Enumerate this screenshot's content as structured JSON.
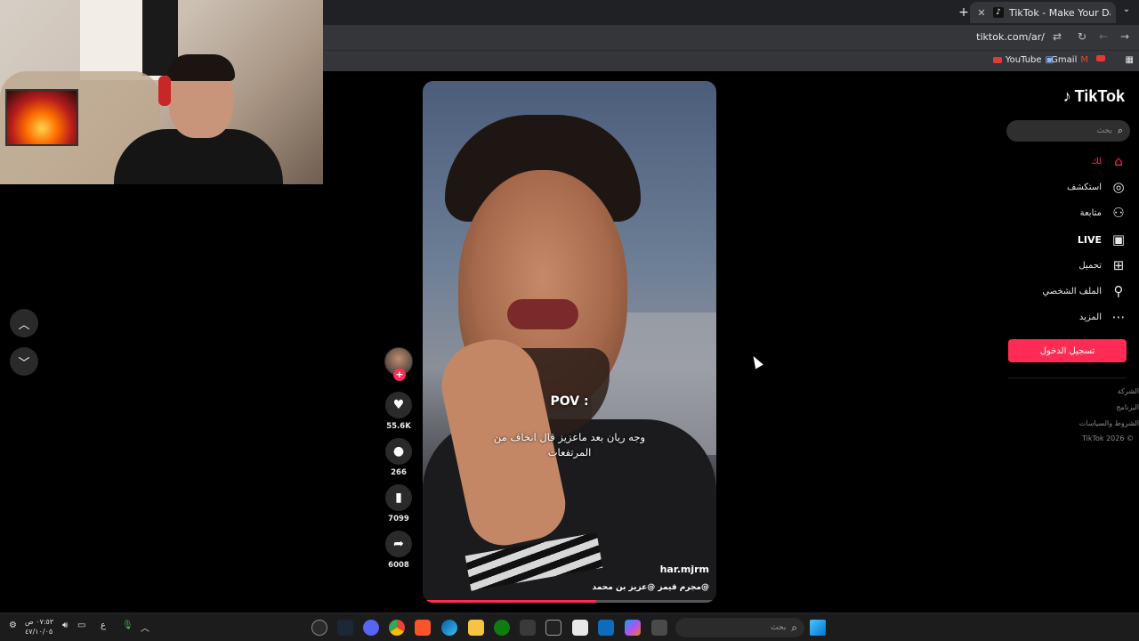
{
  "browser": {
    "tab_title": "TikTok - Make Your Day",
    "tab_favicon": "tiktok-icon",
    "new_tab": "+",
    "url": "tiktok.com/ar/",
    "bookmarks": [
      {
        "label": "YouTube",
        "icon": "youtube-icon"
      },
      {
        "label": "Gmail",
        "icon": "gmail-icon"
      }
    ]
  },
  "tiktok": {
    "logo": "TikTok",
    "search_placeholder": "بحث",
    "nav": [
      {
        "label": "لك",
        "icon": "home-icon",
        "active": true
      },
      {
        "label": "استكشف",
        "icon": "compass-icon"
      },
      {
        "label": "متابعة",
        "icon": "follow-icon"
      },
      {
        "label": "LIVE",
        "icon": "live-icon"
      },
      {
        "label": "تحميل",
        "icon": "upload-icon"
      },
      {
        "label": "الملف الشخصي",
        "icon": "profile-icon"
      },
      {
        "label": "المزيد",
        "icon": "more-icon"
      }
    ],
    "login_button": "تسجيل الدخول",
    "footer": [
      "الشركة",
      "البرنامج",
      "الشروط والسياسات",
      "TikTok 2026 ©"
    ],
    "accent_color": "#fe2c55"
  },
  "video": {
    "caption_pov": "POV :",
    "caption_text": "وجه ريان بعد ماعزيز قال انخاف من المرتفعات",
    "username": "har.mjrm",
    "description": "@مجرم قيمز @عزيز بن محمد",
    "progress": 0.59
  },
  "actions": {
    "likes": "55.6K",
    "comments": "266",
    "saves": "7099",
    "shares": "6008"
  },
  "taskbar": {
    "search_placeholder": "بحث",
    "time": "٠٧:٥٣ ص",
    "date": "٤٧/١٠/٠٥",
    "lang": "ع"
  }
}
